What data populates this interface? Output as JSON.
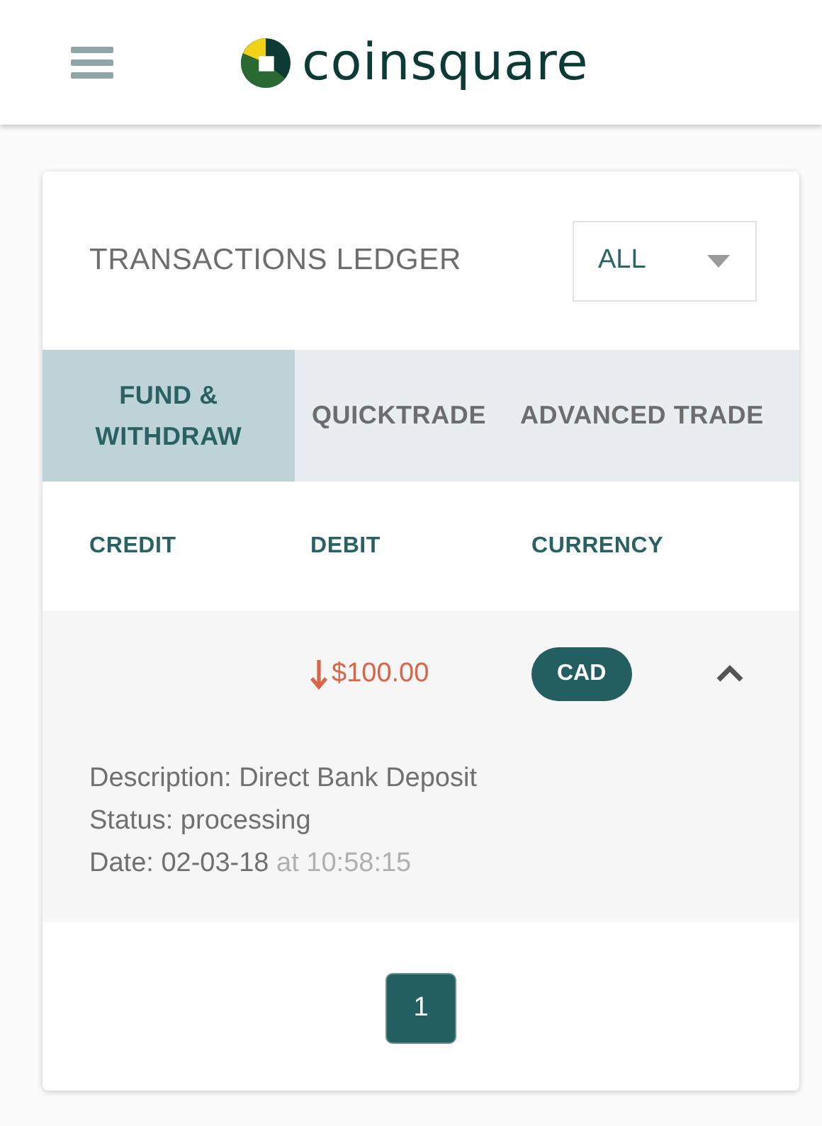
{
  "header": {
    "logo_text": "coinsquare"
  },
  "ledger": {
    "title": "TRANSACTIONS LEDGER",
    "filter": {
      "value": "ALL"
    },
    "tabs": [
      {
        "label": "FUND & WITHDRAW",
        "selected": true
      },
      {
        "label": "QUICKTRADE",
        "selected": false
      },
      {
        "label": "ADVANCED TRADE",
        "selected": false
      }
    ],
    "columns": [
      "CREDIT",
      "DEBIT",
      "CURRENCY"
    ],
    "rows": [
      {
        "debit": "$100.00",
        "kind": "outgoing",
        "currency": "CAD",
        "expanded": true,
        "description": "Description: Direct Bank Deposit",
        "status": "Status: processing",
        "date": "Date: 02-03-18",
        "time": "at 10:58:15"
      }
    ],
    "pages": [
      {
        "label": "1",
        "selected": true
      }
    ]
  }
}
